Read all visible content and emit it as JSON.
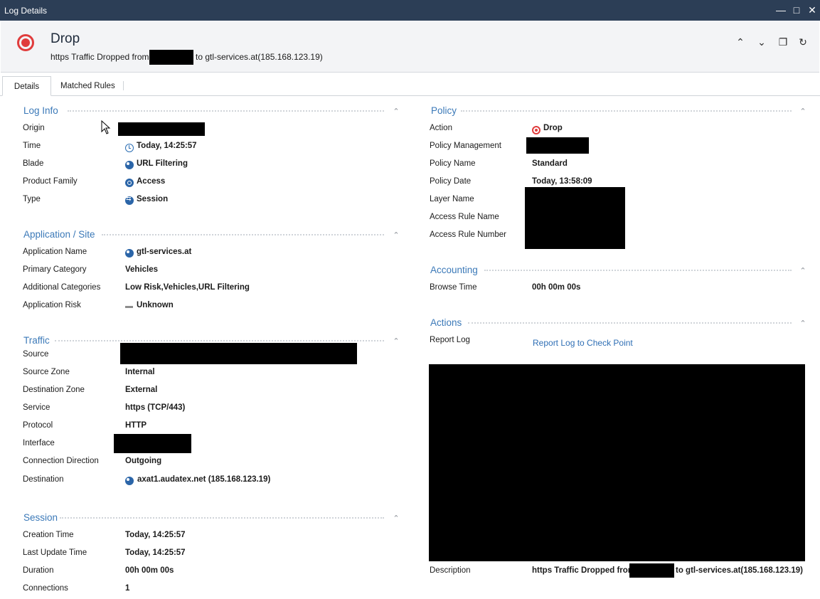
{
  "window": {
    "title": "Log Details",
    "controls": [
      "minimize-icon",
      "maximize-icon",
      "close-icon"
    ]
  },
  "header": {
    "title": "Drop",
    "subtitle_prefix": "https Traffic Dropped from",
    "subtitle_suffix": "to gtl-services.at(185.168.123.19)",
    "buttons": [
      "chevron-up-icon",
      "chevron-down-icon",
      "copy-icon",
      "refresh-icon"
    ]
  },
  "tabs": [
    {
      "label": "Details",
      "active": true
    },
    {
      "label": "Matched Rules",
      "active": false
    }
  ],
  "log_info": {
    "title": "Log Info",
    "rows": [
      {
        "label": "Origin",
        "value": ""
      },
      {
        "label": "Time",
        "value": "Today, 14:25:57"
      },
      {
        "label": "Blade",
        "value": "URL Filtering"
      },
      {
        "label": "Product Family",
        "value": "Access"
      },
      {
        "label": "Type",
        "value": "Session"
      }
    ]
  },
  "application": {
    "title": "Application / Site",
    "rows": [
      {
        "label": "Application Name",
        "value": "gtl-services.at"
      },
      {
        "label": "Primary Category",
        "value": "Vehicles"
      },
      {
        "label": "Additional Categories",
        "value": "Low Risk,Vehicles,URL Filtering"
      },
      {
        "label": "Application Risk",
        "value": "Unknown"
      }
    ]
  },
  "traffic": {
    "title": "Traffic",
    "rows": [
      {
        "label": "Source",
        "value": ""
      },
      {
        "label": "Source Zone",
        "value": "Internal"
      },
      {
        "label": "Destination Zone",
        "value": "External"
      },
      {
        "label": "Service",
        "value": "https (TCP/443)"
      },
      {
        "label": "Protocol",
        "value": "HTTP"
      },
      {
        "label": "Interface",
        "value": ""
      },
      {
        "label": "Connection Direction",
        "value": "Outgoing"
      },
      {
        "label": "Destination",
        "value": "axat1.audatex.net (185.168.123.19)"
      }
    ]
  },
  "session": {
    "title": "Session",
    "rows": [
      {
        "label": "Creation Time",
        "value": "Today, 14:25:57"
      },
      {
        "label": "Last Update Time",
        "value": "Today, 14:25:57"
      },
      {
        "label": "Duration",
        "value": "00h 00m 00s"
      },
      {
        "label": "Connections",
        "value": "1"
      }
    ]
  },
  "policy": {
    "title": "Policy",
    "rows": [
      {
        "label": "Action",
        "value": "Drop"
      },
      {
        "label": "Policy Management",
        "value": ""
      },
      {
        "label": "Policy Name",
        "value": "Standard"
      },
      {
        "label": "Policy Date",
        "value": "Today, 13:58:09"
      },
      {
        "label": "Layer Name",
        "value": ""
      },
      {
        "label": "Access Rule Name",
        "value": ""
      },
      {
        "label": "Access Rule Number",
        "value": ""
      }
    ]
  },
  "accounting": {
    "title": "Accounting",
    "rows": [
      {
        "label": "Browse Time",
        "value": "00h 00m 00s"
      }
    ]
  },
  "actions": {
    "title": "Actions",
    "report_label": "Report Log",
    "report_link": "Report Log to Check Point",
    "description_label": "Description",
    "description_prefix": "https Traffic Dropped from",
    "description_suffix": "to gtl-services.at(185.168.123.19)"
  },
  "colors": {
    "titlebar": "#2c3e56",
    "section_title": "#3b79b8",
    "link": "#2f6fb5",
    "drop_red": "#e03c3c",
    "icon_blue": "#2b65a8"
  }
}
